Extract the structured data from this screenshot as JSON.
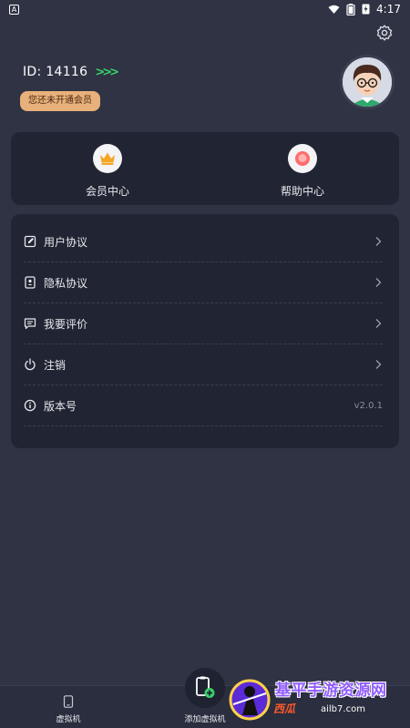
{
  "status_bar": {
    "notification_glyph": "A",
    "time": "4:17",
    "icons": [
      "wifi-icon",
      "battery-icon",
      "charging-icon"
    ]
  },
  "profile": {
    "id_text": "ID: 14116",
    "id_chevrons": ">>>",
    "membership_status": "您还未开通会员"
  },
  "quick_actions": [
    {
      "label": "会员中心",
      "icon": "crown-icon",
      "icon_color": "#f5a623"
    },
    {
      "label": "帮助中心",
      "icon": "help-bubble-icon",
      "icon_color": "#ff6b6b"
    }
  ],
  "menu": [
    {
      "label": "用户协议",
      "icon": "edit-doc-icon"
    },
    {
      "label": "隐私协议",
      "icon": "id-card-icon"
    },
    {
      "label": "我要评价",
      "icon": "comment-icon"
    },
    {
      "label": "注销",
      "icon": "power-icon"
    },
    {
      "label": "版本号",
      "icon": "info-icon",
      "value": "v2.0.1"
    }
  ],
  "tab_bar": {
    "tabs": [
      {
        "label": "虚拟机",
        "icon": "phone-icon"
      },
      {
        "label": "添加虚拟机",
        "icon": "add-device-icon"
      }
    ]
  },
  "watermark": {
    "title": "基平手游资源网",
    "subtitle": "西瓜",
    "url": "ailb7.com"
  },
  "colors": {
    "background": "#2f3344",
    "card": "#212533",
    "accent_green": "#39d06a",
    "badge": "#e8b07a"
  }
}
